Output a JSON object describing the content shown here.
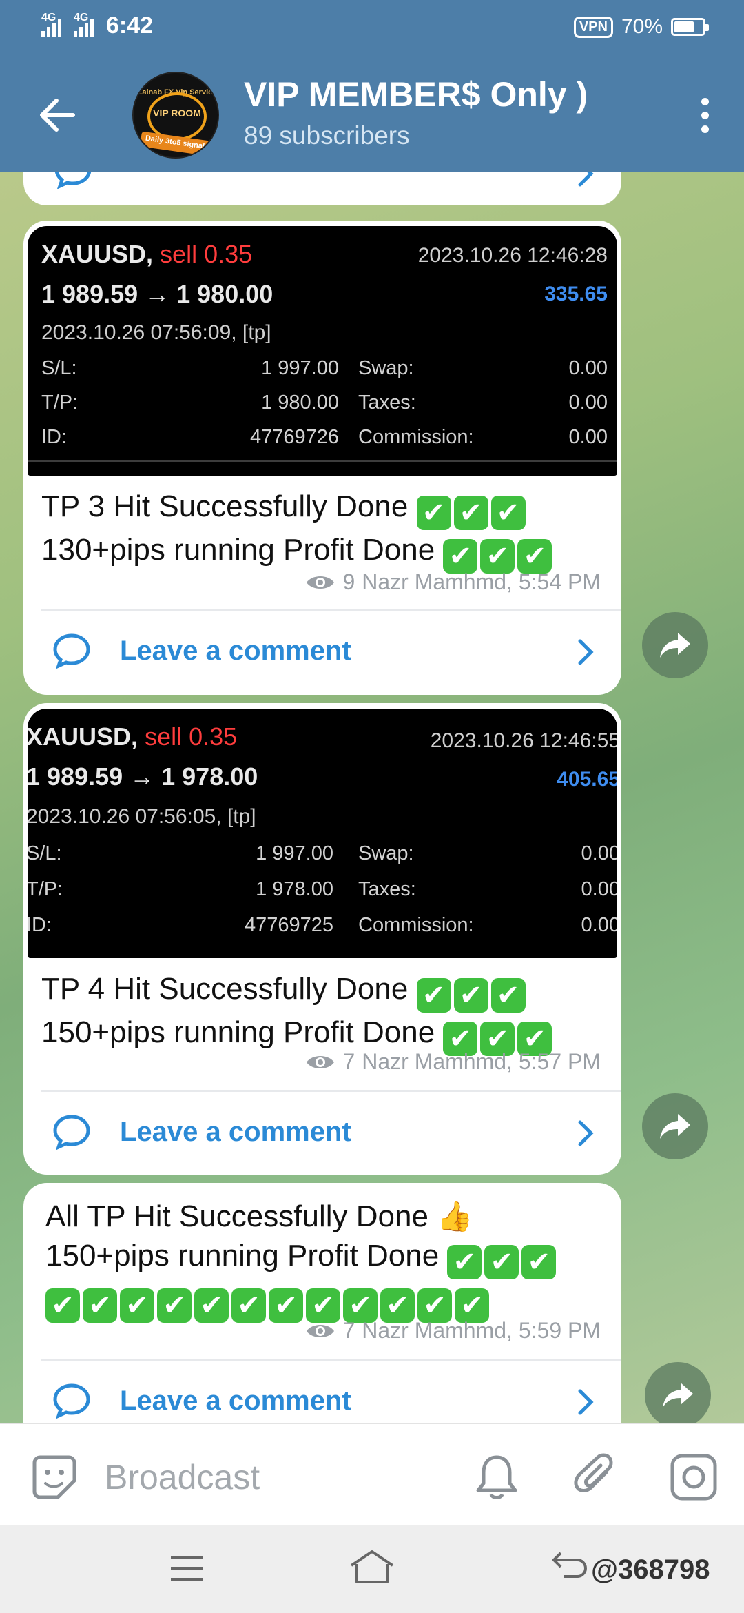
{
  "status_bar": {
    "net1": "4G",
    "net2": "4G",
    "time": "6:42",
    "vpn": "VPN",
    "battery": "70%",
    "battery_level": 0.7
  },
  "header": {
    "title": "VIP MEMBER$ Only )",
    "subscribers": "89 subscribers",
    "avatar_text_top": "Zainab FX Vip Service",
    "avatar_text_mid": "VIP ROOM",
    "avatar_text_band": "Daily 3to5 signals"
  },
  "messages": [
    {
      "screenshot": {
        "symbol": "XAUUSD,",
        "side": "sell 0.35",
        "prices": "1 989.59 → 1 980.00",
        "timestamp": "2023.10.26 12:46:28",
        "profit": "335.65",
        "open_time": "2023.10.26 07:56:09, [tp]",
        "sl_label": "S/L:",
        "sl_value": "1 997.00",
        "tp_label": "T/P:",
        "tp_value": "1 980.00",
        "id_label": "ID:",
        "id_value": "47769726",
        "swap_label": "Swap:",
        "swap_value": "0.00",
        "taxes_label": "Taxes:",
        "taxes_value": "0.00",
        "commission_label": "Commission:",
        "commission_value": "0.00"
      },
      "line1": "TP 3 Hit Successfully Done",
      "line2": "130+pips running Profit Done",
      "views": "9",
      "author_time": "Nazr Mamhmd, 5:54 PM",
      "comment_label": "Leave a comment"
    },
    {
      "screenshot": {
        "symbol": "XAUUSD,",
        "side": "sell 0.35",
        "prices": "1 989.59 → 1 978.00",
        "timestamp": "2023.10.26 12:46:55",
        "profit": "405.65",
        "open_time": "2023.10.26 07:56:05, [tp]",
        "sl_label": "S/L:",
        "sl_value": "1 997.00",
        "tp_label": "T/P:",
        "tp_value": "1 978.00",
        "id_label": "ID:",
        "id_value": "47769725",
        "swap_label": "Swap:",
        "swap_value": "0.00",
        "taxes_label": "Taxes:",
        "taxes_value": "0.00",
        "commission_label": "Commission:",
        "commission_value": "0.00"
      },
      "line1": "TP 4 Hit Successfully Done",
      "line2": "150+pips running Profit Done",
      "views": "7",
      "author_time": "Nazr Mamhmd, 5:57 PM",
      "comment_label": "Leave a comment"
    },
    {
      "line1": "All TP Hit Successfully Done",
      "line2": "150+pips running Profit Done",
      "views": "7",
      "author_time": "Nazr Mamhmd, 5:59 PM",
      "comment_label": "Leave a comment"
    }
  ],
  "checkmark_glyph": "✔",
  "thumb_glyph": "👍",
  "input_bar": {
    "placeholder": "Broadcast"
  },
  "nav": {
    "watermark": "@368798"
  },
  "colors": {
    "header": "#4d7ea8",
    "link": "#2b8ad6",
    "sell": "#ff3d3d",
    "profit": "#3f8df0",
    "check": "#3fbf3f"
  }
}
